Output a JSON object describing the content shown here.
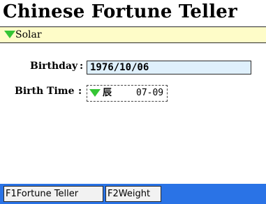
{
  "app": {
    "title": "Chinese Fortune Teller"
  },
  "calendar": {
    "selected": "Solar"
  },
  "form": {
    "birthday_label": "Birthday",
    "birthday_value": "1976/10/06",
    "birthtime_label": "Birth Time",
    "birthtime_hour": "辰",
    "birthtime_range": "07-09"
  },
  "softkeys": [
    {
      "key": "F1",
      "label": "Fortune Teller"
    },
    {
      "key": "F2",
      "label": "Weight"
    }
  ],
  "colors": {
    "calendar_bar": "#fefcc8",
    "input_bg": "#dff0fc",
    "dropdown_arrow": "#35c535",
    "taskbar": "#2a73e6"
  }
}
